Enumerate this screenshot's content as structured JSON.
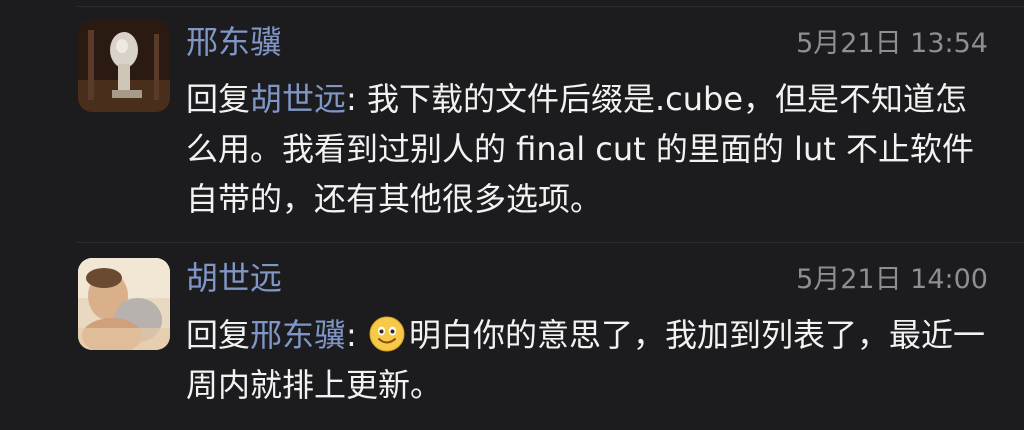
{
  "comments": [
    {
      "avatar_icon": "avatar-photo-statue",
      "author": "邢东骥",
      "timestamp": "5月21日 13:54",
      "reply_prefix": "回复",
      "reply_target": "胡世远",
      "separator": ": ",
      "text": "我下载的文件后缀是.cube，但是不知道怎么用。我看到过别人的 final cut 的里面的 lut 不止软件自带的，还有其他很多选项。"
    },
    {
      "avatar_icon": "avatar-photo-person",
      "author": "胡世远",
      "timestamp": "5月21日 14:00",
      "reply_prefix": "回复",
      "reply_target": "邢东骥",
      "separator": ": ",
      "emoji": "smiley-emoji-icon",
      "text": "明白你的意思了，我加到列表了，最近一周内就排上更新。"
    }
  ],
  "colors": {
    "background": "#1c1c1e",
    "name": "#7f96c6",
    "text": "#f2f2f2",
    "timestamp": "#8e8e93"
  }
}
